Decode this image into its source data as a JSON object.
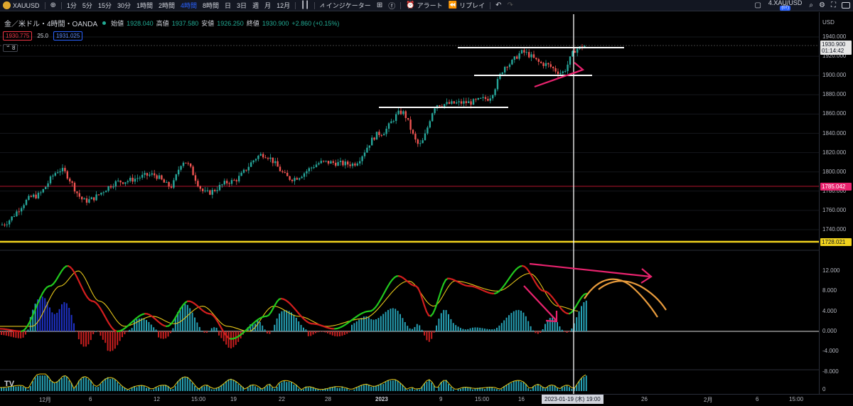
{
  "toolbar": {
    "symbol": "XAUUSD",
    "intervals": [
      "1分",
      "5分",
      "15分",
      "30分",
      "1時間",
      "2時間",
      "4時間",
      "8時間",
      "日",
      "3日",
      "週",
      "月",
      "12月"
    ],
    "active_interval": "4時間",
    "indicators_label": "インジケーター",
    "alert_label": "アラート",
    "replay_label": "リプレイ",
    "compare_symbol": "4.XAU/USD",
    "compare_sub": "(07)"
  },
  "legend": {
    "title": "金／米ドル・4時間・OANDA",
    "open_label": "始値",
    "open": "1928.040",
    "high_label": "高値",
    "high": "1937.580",
    "low_label": "安値",
    "low": "1926.250",
    "close_label": "終値",
    "close": "1930.900",
    "change": "+2.860 (+0.15%)",
    "sell": "1930.775",
    "spread": "25.0",
    "buy": "1931.025",
    "collapse": "8"
  },
  "price_scale": {
    "currency": "USD",
    "labels": [
      "1940.000",
      "1920.000",
      "1900.000",
      "1880.000",
      "1860.000",
      "1840.000",
      "1820.000",
      "1800.000",
      "1780.000",
      "1760.000",
      "1740.000"
    ],
    "current_price": "1930.900",
    "countdown": "01:14:42",
    "red_line_price": "1785.042",
    "yellow_line_price": "1728.021"
  },
  "indicator_scale": {
    "labels": [
      "12.000",
      "8.000",
      "4.000",
      "0.000",
      "-4.000",
      "-8.000"
    ]
  },
  "volume_scale": {
    "labels": [
      "0"
    ]
  },
  "time_axis": {
    "labels": [
      "12月",
      "6",
      "12",
      "15:00",
      "19",
      "22",
      "28",
      "2023",
      "9",
      "15:00",
      "16",
      "26",
      "2月",
      "6",
      "15:00"
    ],
    "cursor_label": "2023-01-19 (木)  19:00"
  },
  "colors": {
    "up": "#26a69a",
    "down": "#ef5350",
    "macd_fast": "#22c81e",
    "macd_signal": "#e6c619",
    "hist_up": "#26a0b4",
    "hist_down": "#c81e1e",
    "hist_blue": "#1e32c8",
    "annotation_pink": "#e8236e",
    "annotation_orange": "#e89b3c",
    "red_line": "#b4142d",
    "yellow_line": "#f0d21e"
  },
  "chart_data": {
    "type": "candlestick",
    "price_series": [
      {
        "t": 0,
        "close": 1745
      },
      {
        "t": 50,
        "close": 1775
      },
      {
        "t": 85,
        "close": 1802
      },
      {
        "t": 120,
        "close": 1770
      },
      {
        "t": 170,
        "close": 1790
      },
      {
        "t": 215,
        "close": 1797
      },
      {
        "t": 240,
        "close": 1785
      },
      {
        "t": 258,
        "close": 1811
      },
      {
        "t": 290,
        "close": 1778
      },
      {
        "t": 325,
        "close": 1790
      },
      {
        "t": 370,
        "close": 1818
      },
      {
        "t": 410,
        "close": 1793
      },
      {
        "t": 455,
        "close": 1810
      },
      {
        "t": 495,
        "close": 1808
      },
      {
        "t": 535,
        "close": 1840
      },
      {
        "t": 565,
        "close": 1862
      },
      {
        "t": 590,
        "close": 1828
      },
      {
        "t": 615,
        "close": 1870
      },
      {
        "t": 660,
        "close": 1872
      },
      {
        "t": 685,
        "close": 1876
      },
      {
        "t": 715,
        "close": 1912
      },
      {
        "t": 735,
        "close": 1924
      },
      {
        "t": 765,
        "close": 1912
      },
      {
        "t": 790,
        "close": 1903
      },
      {
        "t": 812,
        "close": 1928
      },
      {
        "t": 825,
        "close": 1931
      }
    ],
    "indicator_fast": [
      {
        "t": 0,
        "v": 0.5
      },
      {
        "t": 30,
        "v": 0
      },
      {
        "t": 70,
        "v": 9
      },
      {
        "t": 95,
        "v": 13
      },
      {
        "t": 130,
        "v": 6
      },
      {
        "t": 165,
        "v": 0
      },
      {
        "t": 205,
        "v": 3.5
      },
      {
        "t": 235,
        "v": 1
      },
      {
        "t": 265,
        "v": 6
      },
      {
        "t": 295,
        "v": 3.5
      },
      {
        "t": 325,
        "v": -1.5
      },
      {
        "t": 375,
        "v": 3
      },
      {
        "t": 395,
        "v": 6.5
      },
      {
        "t": 440,
        "v": 1.5
      },
      {
        "t": 470,
        "v": 0.5
      },
      {
        "t": 520,
        "v": 4
      },
      {
        "t": 560,
        "v": 11
      },
      {
        "t": 585,
        "v": 9
      },
      {
        "t": 605,
        "v": 3
      },
      {
        "t": 630,
        "v": 10.5
      },
      {
        "t": 660,
        "v": 9
      },
      {
        "t": 695,
        "v": 7.5
      },
      {
        "t": 735,
        "v": 13
      },
      {
        "t": 765,
        "v": 8
      },
      {
        "t": 800,
        "v": 3.5
      },
      {
        "t": 825,
        "v": 7.5
      }
    ],
    "indicator_signal": [
      {
        "t": 0,
        "v": 1
      },
      {
        "t": 45,
        "v": 1
      },
      {
        "t": 85,
        "v": 9
      },
      {
        "t": 110,
        "v": 12
      },
      {
        "t": 140,
        "v": 6
      },
      {
        "t": 175,
        "v": 1
      },
      {
        "t": 215,
        "v": 3
      },
      {
        "t": 245,
        "v": 1.5
      },
      {
        "t": 285,
        "v": 5
      },
      {
        "t": 320,
        "v": 1
      },
      {
        "t": 350,
        "v": 0
      },
      {
        "t": 385,
        "v": 5
      },
      {
        "t": 420,
        "v": 3
      },
      {
        "t": 460,
        "v": 1
      },
      {
        "t": 510,
        "v": 2.5
      },
      {
        "t": 575,
        "v": 10
      },
      {
        "t": 610,
        "v": 5
      },
      {
        "t": 640,
        "v": 10
      },
      {
        "t": 700,
        "v": 8
      },
      {
        "t": 745,
        "v": 11.5
      },
      {
        "t": 785,
        "v": 5
      },
      {
        "t": 815,
        "v": 4
      }
    ],
    "ylim_price": [
      1735,
      1945
    ],
    "ylim_indicator": [
      -8,
      14
    ]
  }
}
